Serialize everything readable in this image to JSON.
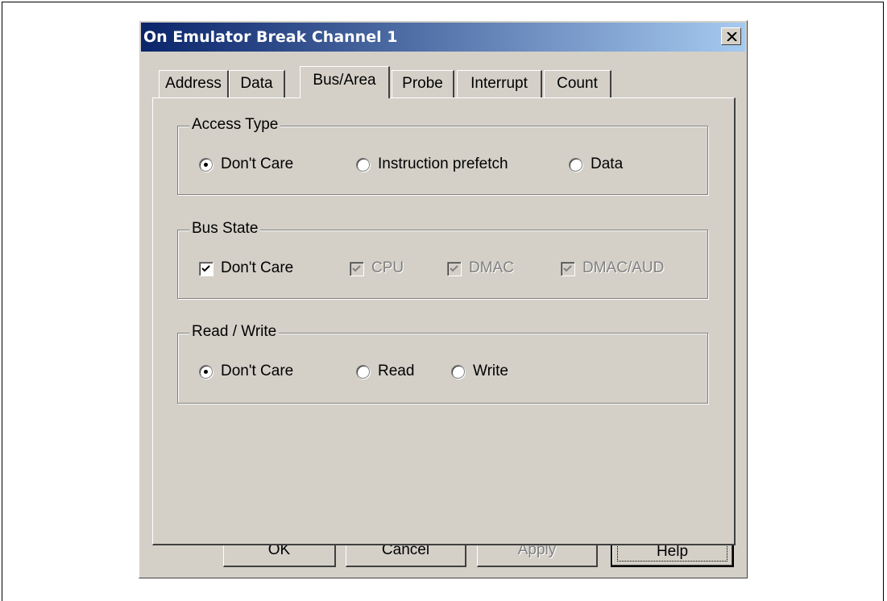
{
  "dialog": {
    "title": "On Emulator Break Channel 1",
    "close_glyph": "✕"
  },
  "tabs": [
    {
      "label": "Address",
      "active": false
    },
    {
      "label": "Data",
      "active": false
    },
    {
      "label": "Bus/Area",
      "active": true
    },
    {
      "label": "Probe",
      "active": false
    },
    {
      "label": "Interrupt",
      "active": false
    },
    {
      "label": "Count",
      "active": false
    }
  ],
  "access_type": {
    "legend": "Access Type",
    "options": [
      {
        "label": "Don't Care",
        "selected": true
      },
      {
        "label": "Instruction prefetch",
        "selected": false
      },
      {
        "label": "Data",
        "selected": false
      }
    ]
  },
  "bus_state": {
    "legend": "Bus State",
    "options": [
      {
        "label": "Don't Care",
        "checked": true,
        "enabled": true
      },
      {
        "label": "CPU",
        "checked": true,
        "enabled": false
      },
      {
        "label": "DMAC",
        "checked": true,
        "enabled": false
      },
      {
        "label": "DMAC/AUD",
        "checked": true,
        "enabled": false
      }
    ]
  },
  "read_write": {
    "legend": "Read / Write",
    "options": [
      {
        "label": "Don't Care",
        "selected": true
      },
      {
        "label": "Read",
        "selected": false
      },
      {
        "label": "Write",
        "selected": false
      }
    ]
  },
  "buttons": {
    "ok": "OK",
    "cancel": "Cancel",
    "apply": "Apply",
    "help": "Help"
  },
  "colors": {
    "face": "#d4d0c8",
    "title_start": "#0a246a",
    "title_end": "#a6caf0",
    "disabled_text": "#808080"
  },
  "icons": {
    "close": "close-icon",
    "radio_selected": "radio-dot-icon",
    "checkmark": "checkmark-icon"
  }
}
